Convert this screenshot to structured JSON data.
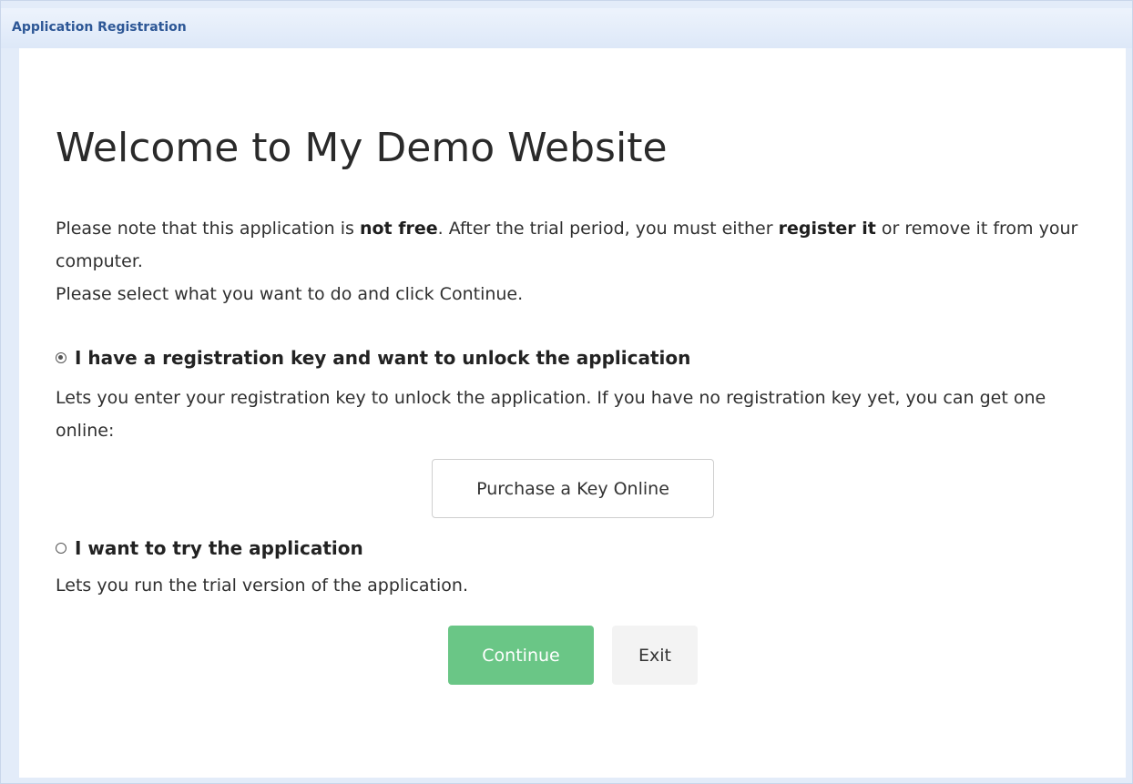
{
  "window": {
    "title": "Application Registration"
  },
  "main": {
    "heading": "Welcome to My Demo Website",
    "intro": {
      "part1": "Please note that this application is ",
      "bold1": "not free",
      "part2": ". After the trial period, you must either ",
      "bold2": "register it",
      "part3": " or remove it from your computer.",
      "line2": "Please select what you want to do and click Continue."
    },
    "options": [
      {
        "label": "I have a registration key and want to unlock the application",
        "selected": true,
        "description": "Lets you enter your registration key to unlock the application. If you have no registration key yet, you can get one online:"
      },
      {
        "label": "I want to try the application",
        "selected": false,
        "description": "Lets you run the trial version of the application."
      }
    ],
    "purchase_button": "Purchase a Key Online",
    "continue_button": "Continue",
    "exit_button": "Exit"
  },
  "colors": {
    "title_text": "#2d5796",
    "continue_bg": "#6ac686",
    "exit_bg": "#f3f3f3",
    "frame_bg": "#e3ecf9"
  },
  "icons": {
    "radio_selected": "radio-checked-icon",
    "radio_unselected": "radio-unchecked-icon"
  }
}
